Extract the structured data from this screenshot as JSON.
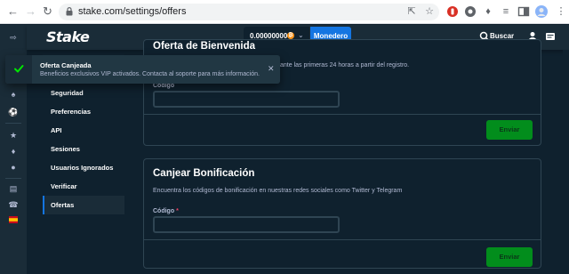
{
  "browser": {
    "url": "stake.com/settings/offers",
    "back_icon": "arrow-left",
    "forward_icon": "arrow-right",
    "reload_icon": "reload"
  },
  "header": {
    "logo": "Stake",
    "balance": "0.00000000",
    "currency_icon": "bitcoin",
    "wallet_label": "Monedero",
    "search_label": "Buscar"
  },
  "menu": {
    "items": [
      {
        "label": "Seguridad",
        "active": false
      },
      {
        "label": "Preferencias",
        "active": false
      },
      {
        "label": "API",
        "active": false
      },
      {
        "label": "Sesiones",
        "active": false
      },
      {
        "label": "Usuarios Ignorados",
        "active": false
      },
      {
        "label": "Verificar",
        "active": false
      },
      {
        "label": "Ofertas",
        "active": true
      }
    ]
  },
  "welcome_offer": {
    "title": "Oferta de Bienvenida",
    "description_fragment": "ante las primeras 24 horas a partir del registro.",
    "code_label": "Código",
    "submit_label": "Enviar"
  },
  "bonus": {
    "title": "Canjear Bonificación",
    "description": "Encuentra los códigos de bonificación en nuestras redes sociales como Twitter y Telegram",
    "code_label": "Código",
    "required_mark": "*",
    "submit_label": "Enviar"
  },
  "toast": {
    "title": "Oferta Canjeada",
    "message": "Beneficios exclusivos VIP activados. Contacta al soporte para más información.",
    "close_icon": "close"
  },
  "colors": {
    "background": "#0f212e",
    "panel": "#1a2c38",
    "accent_blue": "#1475e1",
    "success_green": "#00a019",
    "muted_text": "#b1bad3"
  }
}
